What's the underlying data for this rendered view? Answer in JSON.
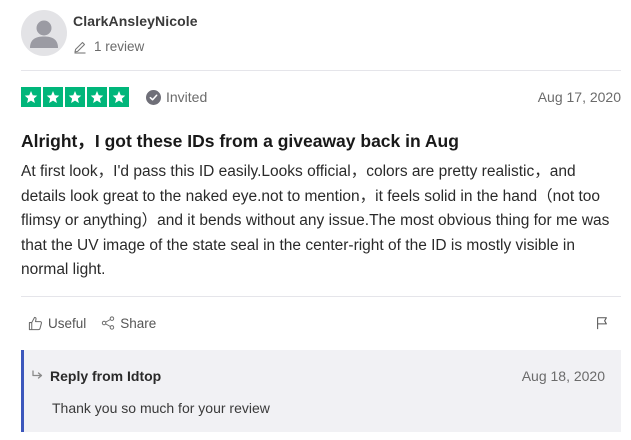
{
  "reviewer": {
    "name": "ClarkAnsleyNicole",
    "review_count": "1 review"
  },
  "review": {
    "rating": 5,
    "rating_max": 5,
    "invited_label": "Invited",
    "date": "Aug 17, 2020",
    "title": "Alright，I got these IDs from a giveaway back in Aug",
    "body": "At first look，I'd pass this ID easily.Looks official，colors are pretty realistic，and details look great to the naked eye.not to mention，it feels solid in the hand（not too flimsy or anything）and it bends without any issue.The most obvious thing for me was that the UV image of the state seal in the center-right of the ID is mostly visible in normal light."
  },
  "actions": {
    "useful_label": "Useful",
    "share_label": "Share"
  },
  "reply": {
    "title": "Reply from Idtop",
    "date": "Aug 18, 2020",
    "text": "Thank you so much for your review"
  },
  "colors": {
    "star_green": "#00b67a",
    "reply_accent": "#3c57bc",
    "reply_bg": "#f1f1f4"
  }
}
